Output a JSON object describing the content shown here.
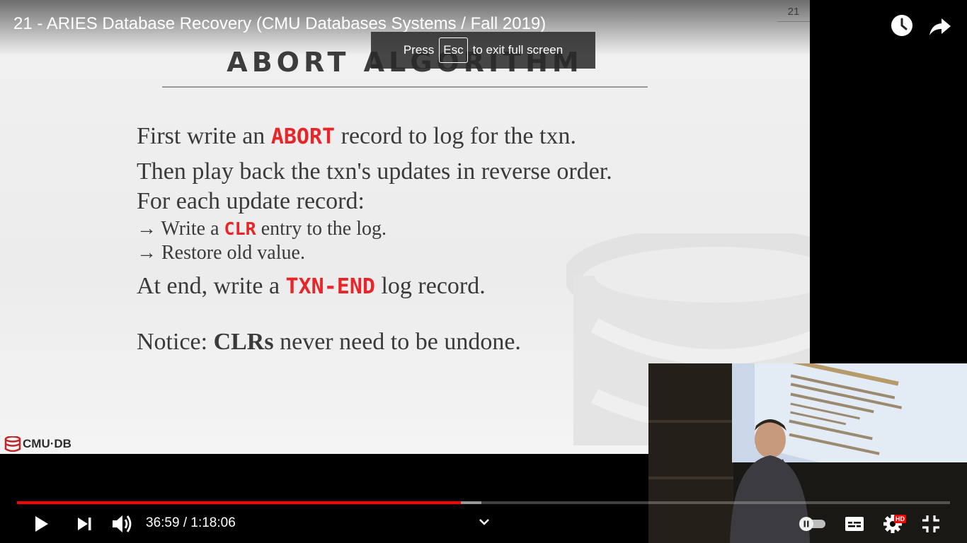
{
  "video": {
    "title": "21 - ARIES Database Recovery (CMU Databases Systems / Fall 2019)",
    "current_time": "36:59",
    "separator": "/",
    "duration": "1:18:06",
    "progress_played_fraction": 0.4755,
    "progress_buffered_fraction": 0.498,
    "quality_badge": "HD"
  },
  "toast": {
    "press": "Press",
    "key": "Esc",
    "rest": "to exit full screen"
  },
  "slide": {
    "number": "21",
    "title": "ABORT ALGORITHM",
    "line1": {
      "a": "First write an ",
      "kw": "ABORT",
      "b": " record to log for the txn."
    },
    "line2": "Then play back the txn's updates in reverse order.",
    "line3": "For each update record:",
    "line4": {
      "arrow": "→",
      "a": " Write a ",
      "kw": "CLR",
      "b": " entry to the log."
    },
    "line5": {
      "arrow": "→",
      "a": " Restore old value."
    },
    "line6": {
      "a": "At end, write a ",
      "kw": "TXN-END",
      "b": " log record."
    },
    "line7": {
      "a": "Notice: ",
      "strong": "CLRs",
      "b": " never need to be undone."
    },
    "logo_text": "CMU·DB"
  },
  "colors": {
    "accent_red": "#e8262a",
    "progress_red": "#ff0000"
  },
  "icons": {
    "watch_later": "clock-icon",
    "share": "share-arrow-icon",
    "play": "play-icon",
    "next": "next-icon",
    "volume": "volume-icon",
    "chapters": "chevron-down-icon",
    "autoplay": "autoplay-toggle-icon",
    "captions": "subtitles-icon",
    "settings": "gear-icon",
    "fullscreen_exit": "exit-fullscreen-icon"
  }
}
